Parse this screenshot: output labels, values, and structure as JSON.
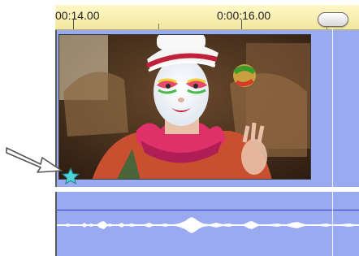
{
  "ruler": {
    "label_left": "00:14.00",
    "label_right": "0:00:16.00"
  },
  "tracks": {
    "video": {
      "clip_icon": "video-thumbnail"
    },
    "audio": {
      "clip_icon": "audio-waveform"
    }
  },
  "icons": {
    "transition_star": "star-icon",
    "annotation_arrow": "arrow-icon",
    "scrubber": "scrubber-thumb"
  },
  "colors": {
    "track_bg": "#9aaaf0",
    "ruler_bg": "#f4ebb0",
    "star": "#4fd3d6"
  }
}
